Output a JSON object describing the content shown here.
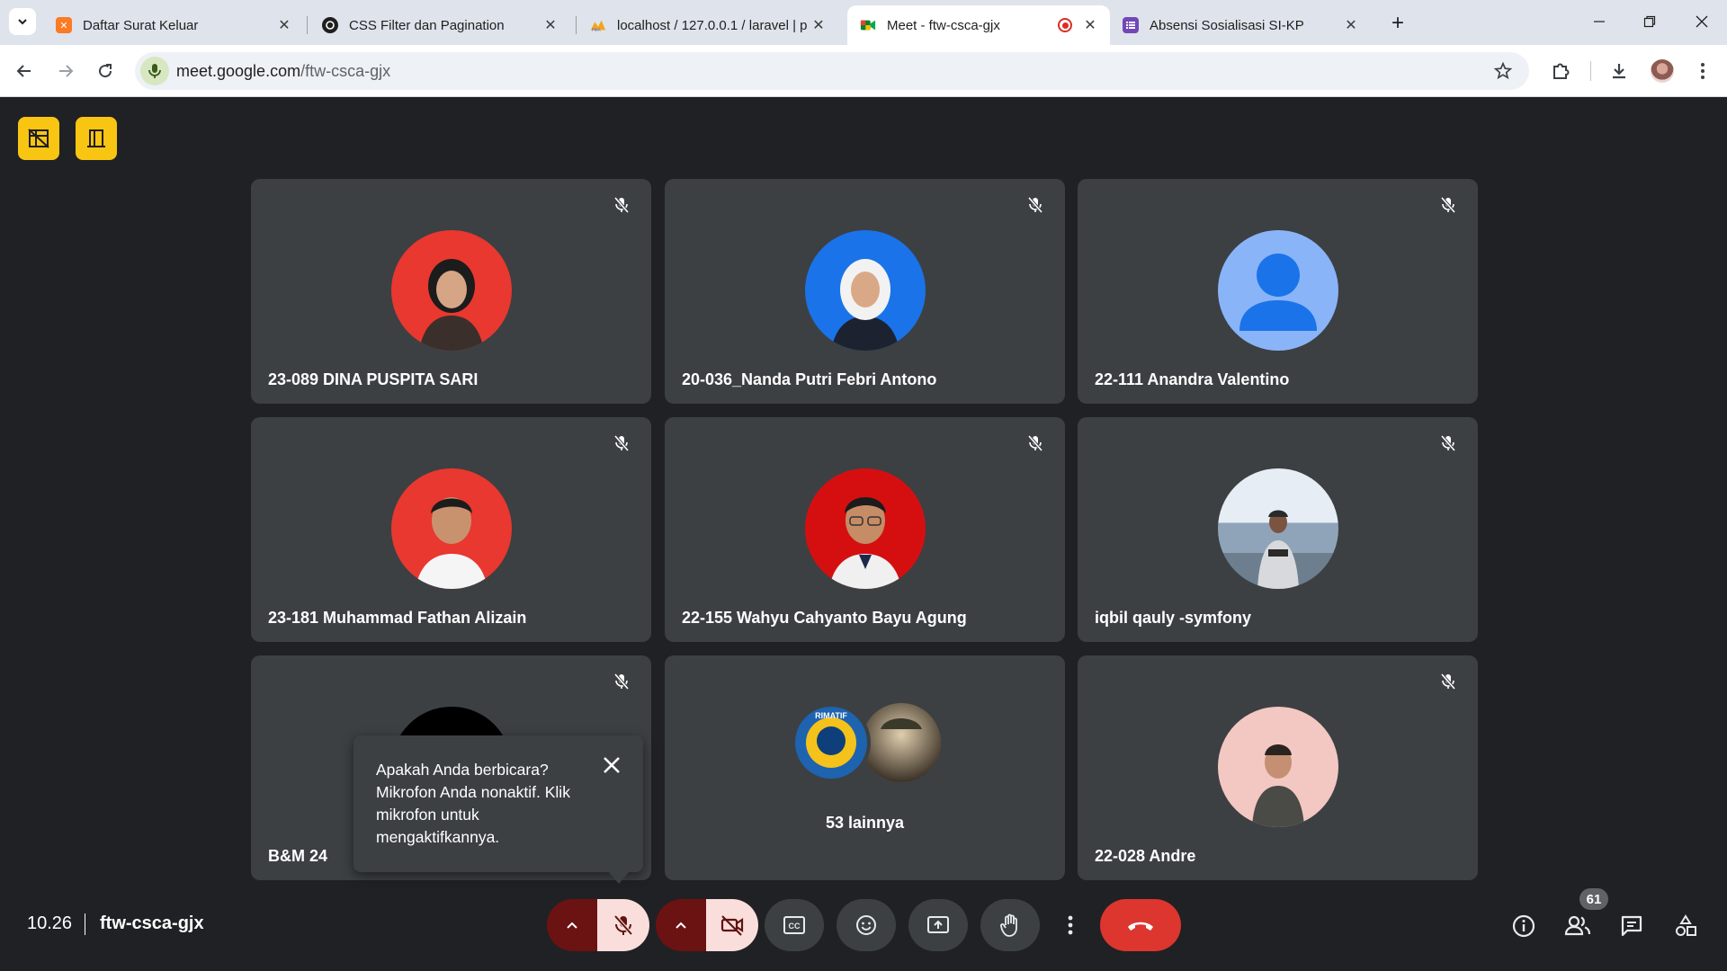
{
  "browser": {
    "tabs": [
      {
        "title": "Daftar Surat Keluar",
        "icon": "xampp-icon"
      },
      {
        "title": "CSS Filter dan Pagination",
        "icon": "chatgpt-icon"
      },
      {
        "title": "localhost / 127.0.0.1 / laravel | p",
        "icon": "phpmyadmin-icon"
      },
      {
        "title": "Meet - ftw-csca-gjx",
        "icon": "google-meet-icon",
        "active": true,
        "recording": true
      },
      {
        "title": "Absensi Sosialisasi SI-KP",
        "icon": "google-forms-icon"
      }
    ],
    "url_host": "meet.google.com",
    "url_path": "/ftw-csca-gjx"
  },
  "participants": [
    {
      "name": "23-089 DINA PUSPITA SARI",
      "muted": true,
      "avatar_bg": "#e8382f",
      "clothing": "#3a2f2b"
    },
    {
      "name": "20-036_Nanda Putri Febri Antono",
      "muted": true,
      "avatar_bg": "#1a73e8",
      "clothing": "#1c2230"
    },
    {
      "name": "22-111 Anandra Valentino",
      "muted": true,
      "avatar_bg": "#8ab4f8",
      "default_avatar": true
    },
    {
      "name": "23-181 Muhammad Fathan Alizain",
      "muted": true,
      "avatar_bg": "#e8382f",
      "clothing": "#f5f5f5"
    },
    {
      "name": "22-155 Wahyu Cahyanto Bayu Agung",
      "muted": true,
      "avatar_bg": "#d50f10",
      "clothing": "#f0f0f0"
    },
    {
      "name": "iqbil qauly -symfony",
      "muted": true,
      "avatar_bg": "#8fa4b8",
      "clothing": "#d7d9dc"
    },
    {
      "name": "B&M 24",
      "muted": true,
      "avatar_bg": "#000000"
    },
    {
      "name": "53 lainnya",
      "others": true
    },
    {
      "name": "22-028 Andre",
      "muted": true,
      "avatar_bg": "#f3c7c2",
      "clothing": "#4a4a47"
    }
  ],
  "tooltip": {
    "text": "Apakah Anda berbicara?\nMikrofon Anda nonaktif. Klik\nmikrofon untuk\nmengaktifkannya."
  },
  "bottom_bar": {
    "time": "10.26",
    "meeting_code": "ftw-csca-gjx",
    "people_count": "61"
  },
  "colors": {
    "meet_bg": "#202124",
    "tile_bg": "#3c4043",
    "hangup": "#dc362e",
    "muted_bg": "#f9dedc",
    "accent_yellow": "#f9c513"
  }
}
